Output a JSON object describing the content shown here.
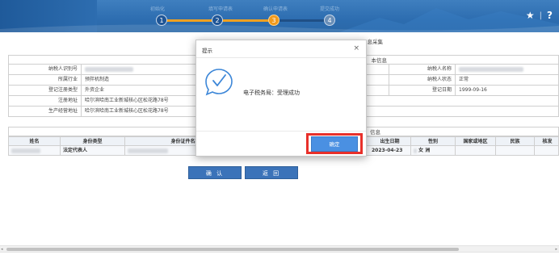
{
  "header": {
    "steps": [
      {
        "number": "1",
        "label": "初始化",
        "state": "done"
      },
      {
        "number": "2",
        "label": "填写申请表",
        "state": "done"
      },
      {
        "number": "3",
        "label": "确认申请表",
        "state": "active"
      },
      {
        "number": "4",
        "label": "提交成功",
        "state": "future"
      }
    ],
    "icons": [
      "star-icon",
      "help-icon"
    ],
    "separator": "|",
    "star_glyph": "★",
    "help_glyph": "?"
  },
  "form": {
    "title": "…息采集",
    "basic_info_title": "本信息",
    "fields_left": [
      {
        "label": "纳税人识别号",
        "value": ""
      },
      {
        "label": "所属行业",
        "value": "预拌机制造"
      },
      {
        "label": "登记注册类型",
        "value": "外资企业"
      },
      {
        "label": "注册地址",
        "value": "哈尔滨哈南工业新城核心区松花路78号"
      },
      {
        "label": "生产经营地址",
        "value": "哈尔滨哈南工业新城核心区松花路78号"
      }
    ],
    "fields_right": [
      {
        "label": "纳税人名称",
        "value": ""
      },
      {
        "label": "纳税人状态",
        "value": "正常"
      },
      {
        "label": "登记日期",
        "value": "1999-09-16"
      }
    ],
    "people_title": "信息",
    "table_headers": [
      "姓名",
      "身份类型",
      "身份证件名称",
      "出生日期",
      "性别",
      "国家或地区",
      "民族",
      "核发"
    ],
    "table_rows": [
      {
        "name": "",
        "identity_type": "法定代表人",
        "id_doc": "",
        "birth_date": "2023-04-23",
        "gender": "女",
        "country": "",
        "ethnicity": "",
        "issuer": ""
      }
    ],
    "gender_suffix": "洲",
    "confirm_button": "确 认",
    "back_button": "返 回"
  },
  "modal": {
    "title": "提示",
    "close_glyph": "×",
    "message": "电子税务局：受理成功",
    "ok_button": "确定",
    "icon": "check-bubble-icon"
  },
  "scrollbar": {
    "left_arrow": "◂",
    "right_arrow": "▸"
  }
}
